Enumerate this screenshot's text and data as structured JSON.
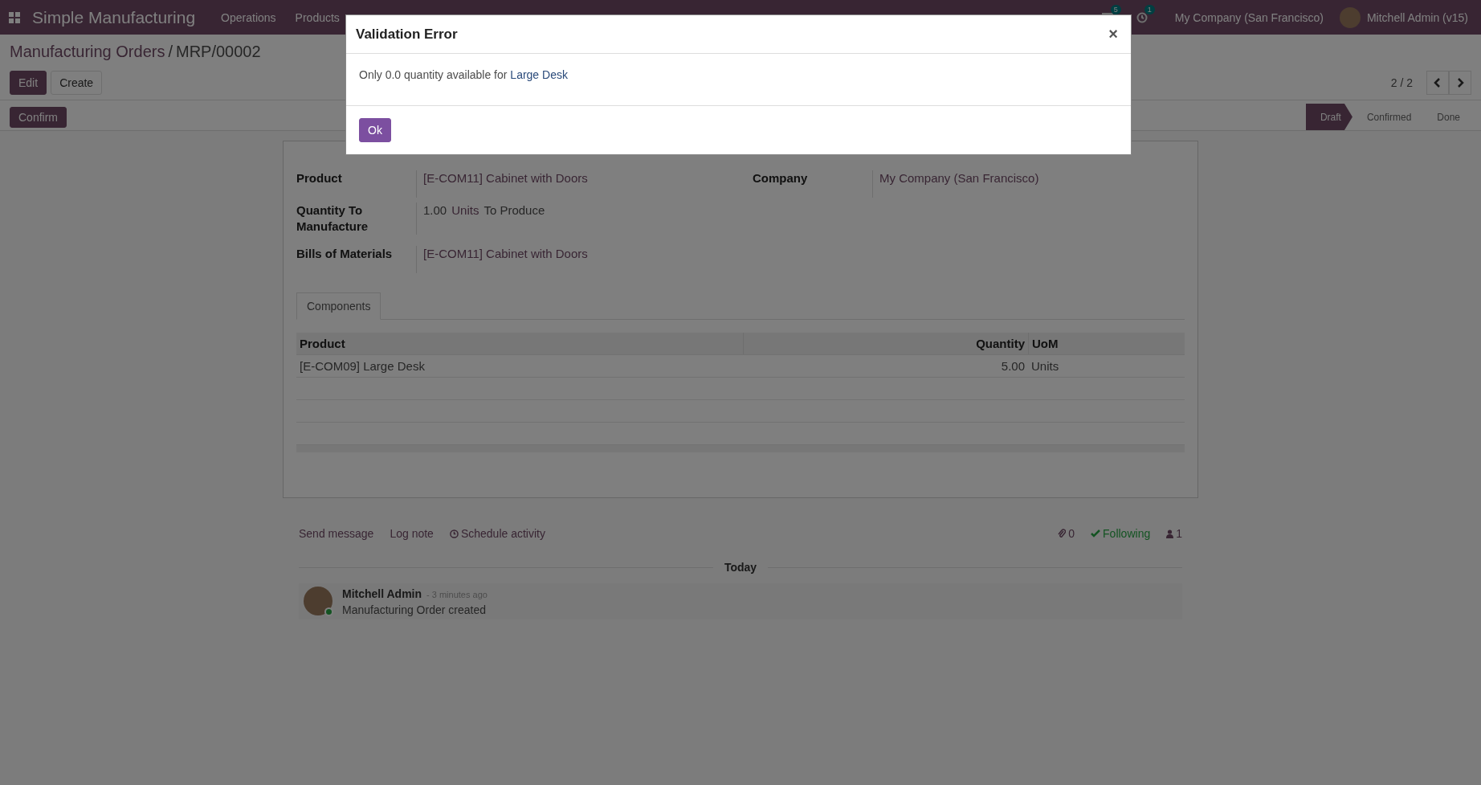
{
  "navbar": {
    "app_name": "Simple Manufacturing",
    "menus": [
      "Operations",
      "Products"
    ],
    "chat_badge": "5",
    "activity_badge": "1",
    "company": "My Company (San Francisco)",
    "user": "Mitchell Admin (v15)"
  },
  "breadcrumb": {
    "parent": "Manufacturing Orders",
    "separator": "/",
    "current": "MRP/00002"
  },
  "actions": [
    "Edit",
    "Create"
  ],
  "pager": "2 / 2",
  "header_buttons": [
    "Confirm"
  ],
  "statusbar": [
    {
      "label": "Draft",
      "selected": true
    },
    {
      "label": "Confirmed",
      "selected": false
    },
    {
      "label": "Done",
      "selected": false
    }
  ],
  "form": {
    "left": [
      {
        "label": "Product",
        "kind": "link",
        "value": "[E-COM11] Cabinet with Doors"
      },
      {
        "label": "Quantity To Manufacture",
        "kind": "quantity",
        "qty": "1.00",
        "uom": "Units",
        "suffix": "To Produce"
      }
    ],
    "right": [
      {
        "label": "Company",
        "kind": "link",
        "value": "My Company (San Francisco)"
      }
    ],
    "bom": {
      "label": "Bills of Materials",
      "kind": "link",
      "value": "[E-COM11] Cabinet with Doors"
    },
    "tabs": [
      {
        "label": "Components",
        "selected": true
      }
    ],
    "table": {
      "columns": [
        "Product",
        "Quantity",
        "UoM"
      ],
      "rows": [
        [
          "[E-COM09] Large Desk",
          "5.00",
          "Units"
        ]
      ]
    }
  },
  "chatter": {
    "actions": [
      "Send message",
      "Log note",
      "Schedule activity"
    ],
    "attachments": "0",
    "following": "Following",
    "followers": "1",
    "date_separator": "Today",
    "messages": [
      {
        "author": "Mitchell Admin",
        "time": "- 3 minutes ago",
        "body": "Manufacturing Order created",
        "online": true
      }
    ]
  },
  "dialog": {
    "title": "Validation Error",
    "close": "×",
    "message_prefix": "Only 0.0 quantity available for ",
    "message_link": "Large Desk",
    "button": "Ok"
  }
}
